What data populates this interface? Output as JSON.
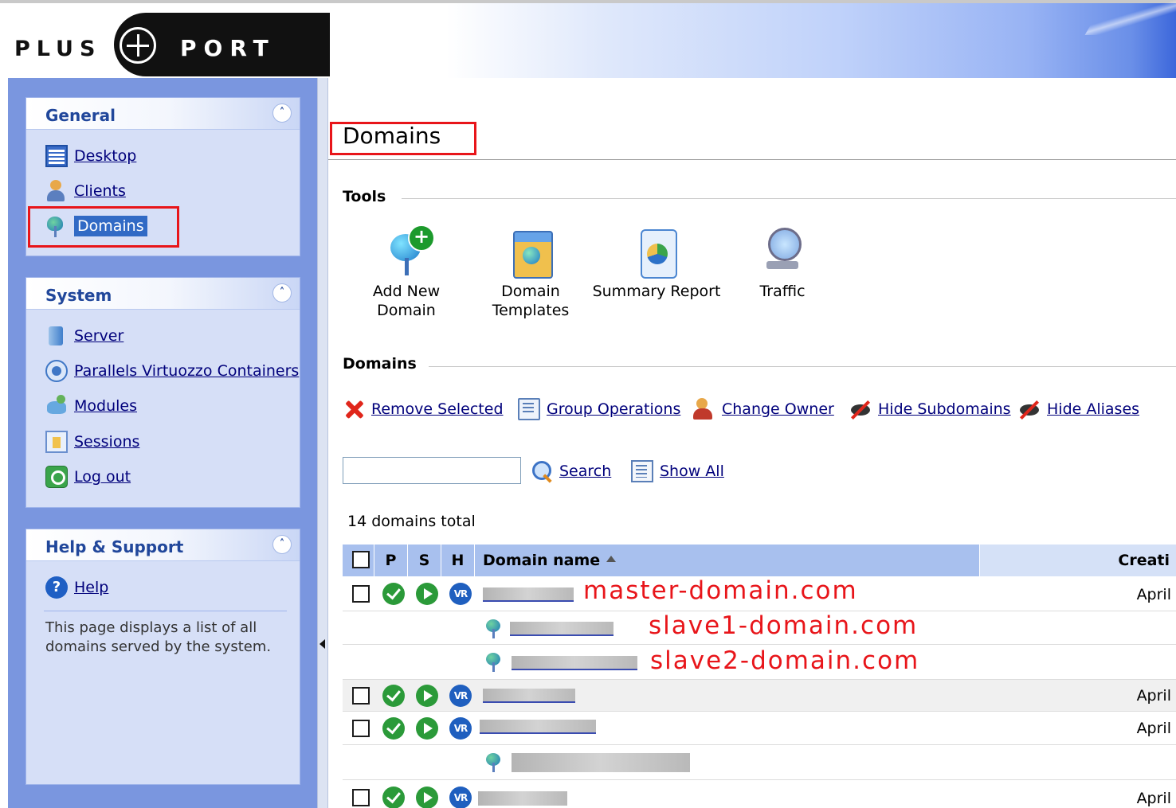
{
  "brand": {
    "left": "PLUS",
    "right": "PORT"
  },
  "nav": {
    "general": {
      "title": "General",
      "items": [
        {
          "label": "Desktop",
          "icon": "desktop-icon"
        },
        {
          "label": "Clients",
          "icon": "clients-icon"
        },
        {
          "label": "Domains",
          "icon": "domains-icon",
          "selected": true
        }
      ]
    },
    "system": {
      "title": "System",
      "items": [
        {
          "label": "Server",
          "icon": "server-icon"
        },
        {
          "label": "Parallels Virtuozzo Containers",
          "icon": "virtuozzo-icon"
        },
        {
          "label": "Modules",
          "icon": "modules-icon"
        },
        {
          "label": "Sessions",
          "icon": "sessions-icon"
        },
        {
          "label": "Log out",
          "icon": "logout-icon"
        }
      ]
    },
    "help": {
      "title": "Help & Support",
      "link": "Help",
      "text": "This page displays a list of all domains served by the system."
    }
  },
  "main": {
    "title": "Domains",
    "tools_title": "Tools",
    "tools": [
      {
        "label": "Add New Domain",
        "icon": "add-domain-icon"
      },
      {
        "label": "Domain Templates",
        "icon": "domain-templates-icon"
      },
      {
        "label": "Summary Report",
        "icon": "summary-report-icon"
      },
      {
        "label": "Traffic",
        "icon": "traffic-icon"
      }
    ],
    "domains_title": "Domains",
    "actions": [
      {
        "label": "Remove Selected",
        "icon": "remove-icon"
      },
      {
        "label": "Group Operations",
        "icon": "group-operations-icon"
      },
      {
        "label": "Change Owner",
        "icon": "change-owner-icon"
      },
      {
        "label": "Hide Subdomains",
        "icon": "hide-icon"
      },
      {
        "label": "Hide Aliases",
        "icon": "hide-icon"
      }
    ],
    "search": {
      "value": "",
      "button": "Search",
      "show_all": "Show All"
    },
    "total": "14 domains total",
    "table": {
      "headers": {
        "p": "P",
        "s": "S",
        "h": "H",
        "name": "Domain name",
        "created": "Creati"
      },
      "status_vr": "VR",
      "rows": [
        {
          "annotation": "master-domain.com",
          "date": "April"
        },
        {
          "annotation": "slave1-domain.com"
        },
        {
          "annotation": "slave2-domain.com"
        },
        {
          "date": "April"
        },
        {
          "date": "April"
        },
        {},
        {
          "date": "April"
        }
      ]
    }
  },
  "colors": {
    "nav_bg": "#7a96df",
    "panel_bg": "#d6dff7",
    "header_title": "#21479b",
    "annotation_red": "#e8151a",
    "status_green": "#2b9a39",
    "table_header": "#a8c0ee"
  }
}
